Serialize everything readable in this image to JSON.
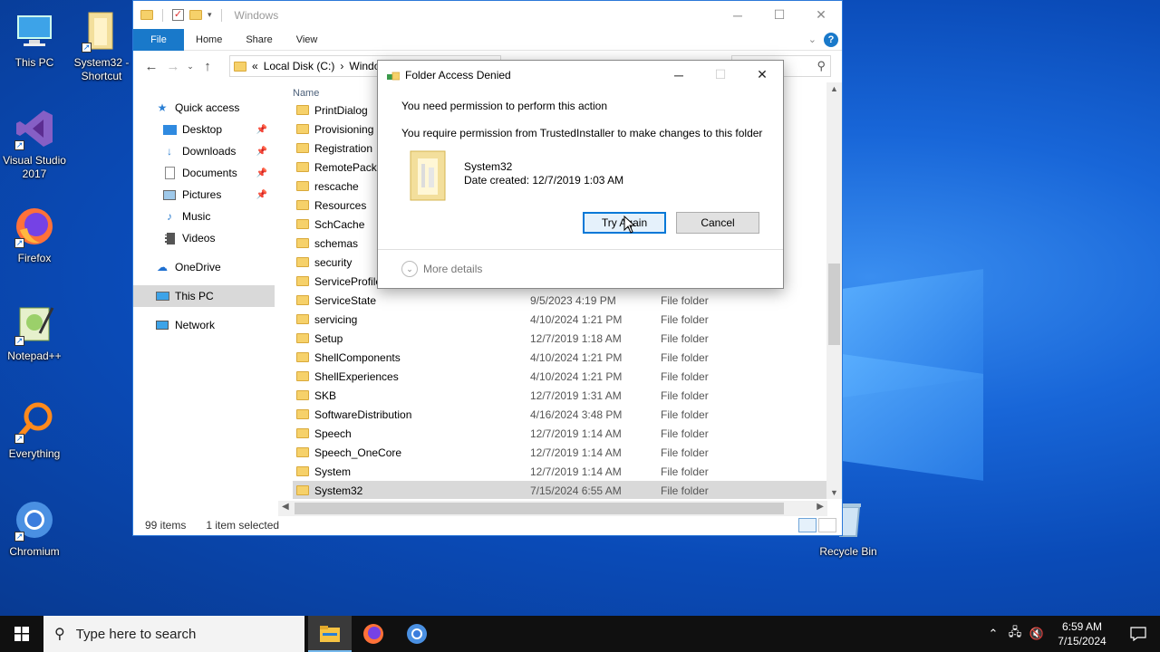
{
  "desktop": {
    "icons": [
      {
        "label": "This PC"
      },
      {
        "label": "System32 - Shortcut"
      },
      {
        "label": "Visual Studio 2017"
      },
      {
        "label": "Firefox"
      },
      {
        "label": "Notepad++"
      },
      {
        "label": "Everything"
      },
      {
        "label": "Chromium"
      },
      {
        "label": "Recycle Bin"
      }
    ]
  },
  "explorer": {
    "title": "Windows",
    "ribbon_tabs": [
      "File",
      "Home",
      "Share",
      "View"
    ],
    "help_label": "?",
    "address": {
      "prefix": "«",
      "crumb1": "Local Disk (C:)",
      "sep": "›",
      "crumb2": "Windows"
    },
    "sidebar": {
      "quick_access": "Quick access",
      "items": [
        "Desktop",
        "Downloads",
        "Documents",
        "Pictures",
        "Music",
        "Videos"
      ],
      "onedrive": "OneDrive",
      "this_pc": "This PC",
      "network": "Network"
    },
    "column_name": "Name",
    "files": [
      {
        "name": "PrintDialog",
        "date": "",
        "type": ""
      },
      {
        "name": "Provisioning",
        "date": "",
        "type": ""
      },
      {
        "name": "Registration",
        "date": "",
        "type": ""
      },
      {
        "name": "RemotePackages",
        "date": "",
        "type": ""
      },
      {
        "name": "rescache",
        "date": "",
        "type": ""
      },
      {
        "name": "Resources",
        "date": "",
        "type": ""
      },
      {
        "name": "SchCache",
        "date": "",
        "type": ""
      },
      {
        "name": "schemas",
        "date": "",
        "type": ""
      },
      {
        "name": "security",
        "date": "",
        "type": ""
      },
      {
        "name": "ServiceProfiles",
        "date": "",
        "type": ""
      },
      {
        "name": "ServiceState",
        "date": "9/5/2023 4:19 PM",
        "type": "File folder"
      },
      {
        "name": "servicing",
        "date": "4/10/2024 1:21 PM",
        "type": "File folder"
      },
      {
        "name": "Setup",
        "date": "12/7/2019 1:18 AM",
        "type": "File folder"
      },
      {
        "name": "ShellComponents",
        "date": "4/10/2024 1:21 PM",
        "type": "File folder"
      },
      {
        "name": "ShellExperiences",
        "date": "4/10/2024 1:21 PM",
        "type": "File folder"
      },
      {
        "name": "SKB",
        "date": "12/7/2019 1:31 AM",
        "type": "File folder"
      },
      {
        "name": "SoftwareDistribution",
        "date": "4/16/2024 3:48 PM",
        "type": "File folder"
      },
      {
        "name": "Speech",
        "date": "12/7/2019 1:14 AM",
        "type": "File folder"
      },
      {
        "name": "Speech_OneCore",
        "date": "12/7/2019 1:14 AM",
        "type": "File folder"
      },
      {
        "name": "System",
        "date": "12/7/2019 1:14 AM",
        "type": "File folder"
      },
      {
        "name": "System32",
        "date": "7/15/2024 6:55 AM",
        "type": "File folder"
      }
    ],
    "status": {
      "count": "99 items",
      "selected": "1 item selected"
    }
  },
  "dialog": {
    "title": "Folder Access Denied",
    "heading": "You need permission to perform this action",
    "message": "You require permission from TrustedInstaller to make changes to this folder",
    "folder_name": "System32",
    "date_created": "Date created: 12/7/2019 1:03 AM",
    "try_again": "Try Again",
    "cancel": "Cancel",
    "more_details": "More details"
  },
  "taskbar": {
    "search_placeholder": "Type here to search",
    "time": "6:59 AM",
    "date": "7/15/2024"
  },
  "colors": {
    "accent": "#1979ca",
    "desktop": "#0a4fb8",
    "taskbar": "#101010"
  }
}
